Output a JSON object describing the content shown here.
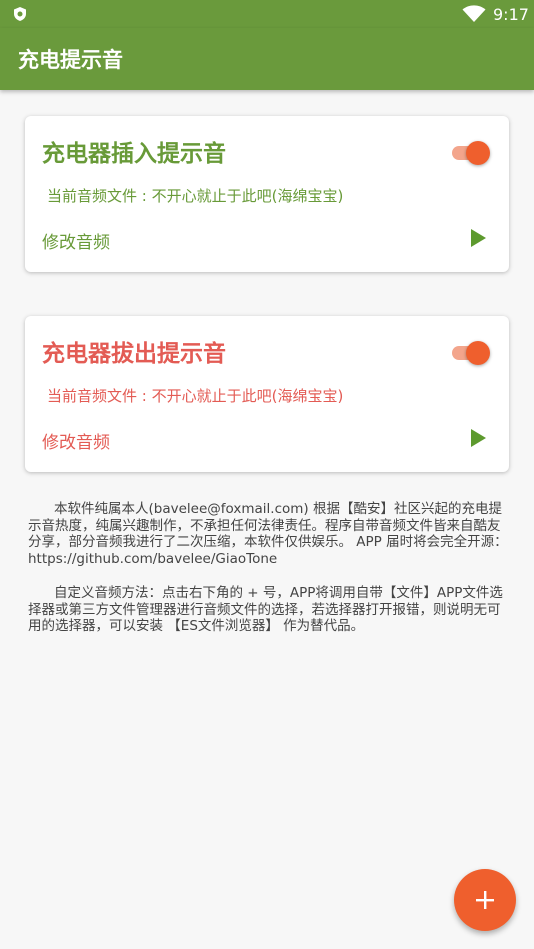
{
  "status_bar": {
    "time": "9:17",
    "left_icon": "shield-icon",
    "signal_icon": "wifi-icon"
  },
  "app_bar": {
    "title": "充电提示音",
    "color": "#6a9a3c"
  },
  "cards": [
    {
      "title": "充电器插入提示音",
      "file_text": "当前音频文件 : 不开心就止于此吧(海绵宝宝)",
      "edit_label": "修改音频",
      "enabled": true,
      "accent": "#689a38"
    },
    {
      "title": "充电器拔出提示音",
      "file_text": "当前音频文件 : 不开心就止于此吧(海绵宝宝)",
      "edit_label": "修改音频",
      "enabled": true,
      "accent": "#e35b54"
    }
  ],
  "info": {
    "paragraph1": "本软件纯属本人(bavelee@foxmail.com)   根据【酷安】社区兴起的充电提示音热度，纯属兴趣制作，不承担任何法律责任。程序自带音频文件皆来自酷友分享，部分音频我进行了二次压缩，本软件仅供娱乐。 APP 届时将会完全开源：https://github.com/bavelee/GiaoTone",
    "paragraph2": "自定义音频方法：点击右下角的 + 号，APP将调用自带【文件】APP文件选择器或第三方文件管理器进行音频文件的选择，若选择器打开报错，则说明无可用的选择器，可以安装 【ES文件浏览器】 作为替代品。"
  },
  "fab": {
    "icon": "plus-icon",
    "color": "#ef5f2d"
  },
  "play_icon_color": "#5d9a2e"
}
